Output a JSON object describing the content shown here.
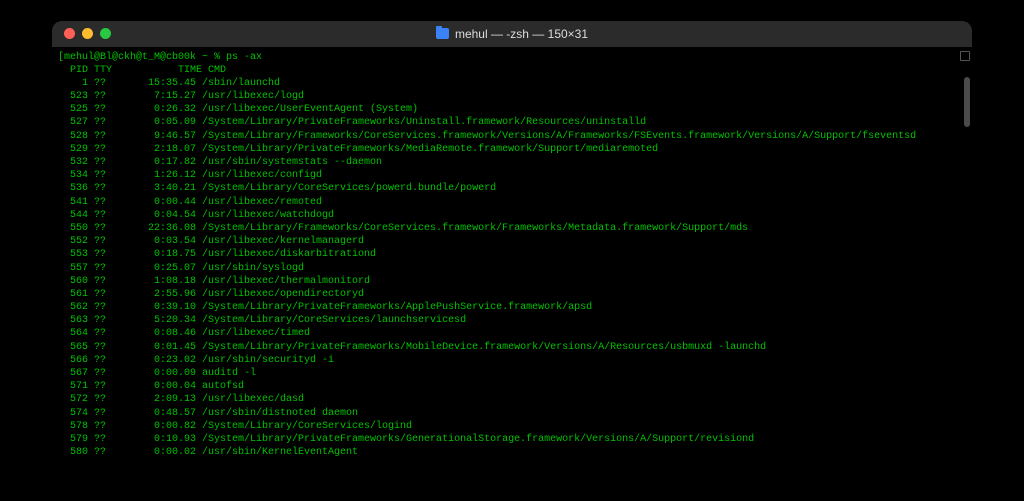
{
  "window": {
    "title": "mehul — -zsh — 150×31"
  },
  "terminal": {
    "prompt": "[mehul@Bl@ckh@t_M@cb00k ~ % ps -ax",
    "header": "  PID TTY           TIME CMD",
    "rows": [
      {
        "pid": "1",
        "tty": "??",
        "time": "15:35.45",
        "cmd": "/sbin/launchd"
      },
      {
        "pid": "523",
        "tty": "??",
        "time": "7:15.27",
        "cmd": "/usr/libexec/logd"
      },
      {
        "pid": "525",
        "tty": "??",
        "time": "0:26.32",
        "cmd": "/usr/libexec/UserEventAgent (System)"
      },
      {
        "pid": "527",
        "tty": "??",
        "time": "0:05.09",
        "cmd": "/System/Library/PrivateFrameworks/Uninstall.framework/Resources/uninstalld"
      },
      {
        "pid": "528",
        "tty": "??",
        "time": "9:46.57",
        "cmd": "/System/Library/Frameworks/CoreServices.framework/Versions/A/Frameworks/FSEvents.framework/Versions/A/Support/fseventsd"
      },
      {
        "pid": "529",
        "tty": "??",
        "time": "2:18.07",
        "cmd": "/System/Library/PrivateFrameworks/MediaRemote.framework/Support/mediaremoted"
      },
      {
        "pid": "532",
        "tty": "??",
        "time": "0:17.82",
        "cmd": "/usr/sbin/systemstats --daemon"
      },
      {
        "pid": "534",
        "tty": "??",
        "time": "1:26.12",
        "cmd": "/usr/libexec/configd"
      },
      {
        "pid": "536",
        "tty": "??",
        "time": "3:40.21",
        "cmd": "/System/Library/CoreServices/powerd.bundle/powerd"
      },
      {
        "pid": "541",
        "tty": "??",
        "time": "0:00.44",
        "cmd": "/usr/libexec/remoted"
      },
      {
        "pid": "544",
        "tty": "??",
        "time": "0:04.54",
        "cmd": "/usr/libexec/watchdogd"
      },
      {
        "pid": "550",
        "tty": "??",
        "time": "22:36.08",
        "cmd": "/System/Library/Frameworks/CoreServices.framework/Frameworks/Metadata.framework/Support/mds"
      },
      {
        "pid": "552",
        "tty": "??",
        "time": "0:03.54",
        "cmd": "/usr/libexec/kernelmanagerd"
      },
      {
        "pid": "553",
        "tty": "??",
        "time": "0:18.75",
        "cmd": "/usr/libexec/diskarbitrationd"
      },
      {
        "pid": "557",
        "tty": "??",
        "time": "0:25.07",
        "cmd": "/usr/sbin/syslogd"
      },
      {
        "pid": "560",
        "tty": "??",
        "time": "1:08.18",
        "cmd": "/usr/libexec/thermalmonitord"
      },
      {
        "pid": "561",
        "tty": "??",
        "time": "2:55.96",
        "cmd": "/usr/libexec/opendirectoryd"
      },
      {
        "pid": "562",
        "tty": "??",
        "time": "0:39.10",
        "cmd": "/System/Library/PrivateFrameworks/ApplePushService.framework/apsd"
      },
      {
        "pid": "563",
        "tty": "??",
        "time": "5:20.34",
        "cmd": "/System/Library/CoreServices/launchservicesd"
      },
      {
        "pid": "564",
        "tty": "??",
        "time": "0:08.46",
        "cmd": "/usr/libexec/timed"
      },
      {
        "pid": "565",
        "tty": "??",
        "time": "0:01.45",
        "cmd": "/System/Library/PrivateFrameworks/MobileDevice.framework/Versions/A/Resources/usbmuxd -launchd"
      },
      {
        "pid": "566",
        "tty": "??",
        "time": "0:23.02",
        "cmd": "/usr/sbin/securityd -i"
      },
      {
        "pid": "567",
        "tty": "??",
        "time": "0:00.09",
        "cmd": "auditd -l"
      },
      {
        "pid": "571",
        "tty": "??",
        "time": "0:00.04",
        "cmd": "autofsd"
      },
      {
        "pid": "572",
        "tty": "??",
        "time": "2:09.13",
        "cmd": "/usr/libexec/dasd"
      },
      {
        "pid": "574",
        "tty": "??",
        "time": "0:48.57",
        "cmd": "/usr/sbin/distnoted daemon"
      },
      {
        "pid": "578",
        "tty": "??",
        "time": "0:00.82",
        "cmd": "/System/Library/CoreServices/logind"
      },
      {
        "pid": "579",
        "tty": "??",
        "time": "0:10.93",
        "cmd": "/System/Library/PrivateFrameworks/GenerationalStorage.framework/Versions/A/Support/revisiond"
      },
      {
        "pid": "580",
        "tty": "??",
        "time": "0:00.02",
        "cmd": "/usr/sbin/KernelEventAgent"
      }
    ]
  },
  "colors": {
    "text": "#00c200",
    "bg": "#000000",
    "titlebar": "#2b2b2b"
  }
}
